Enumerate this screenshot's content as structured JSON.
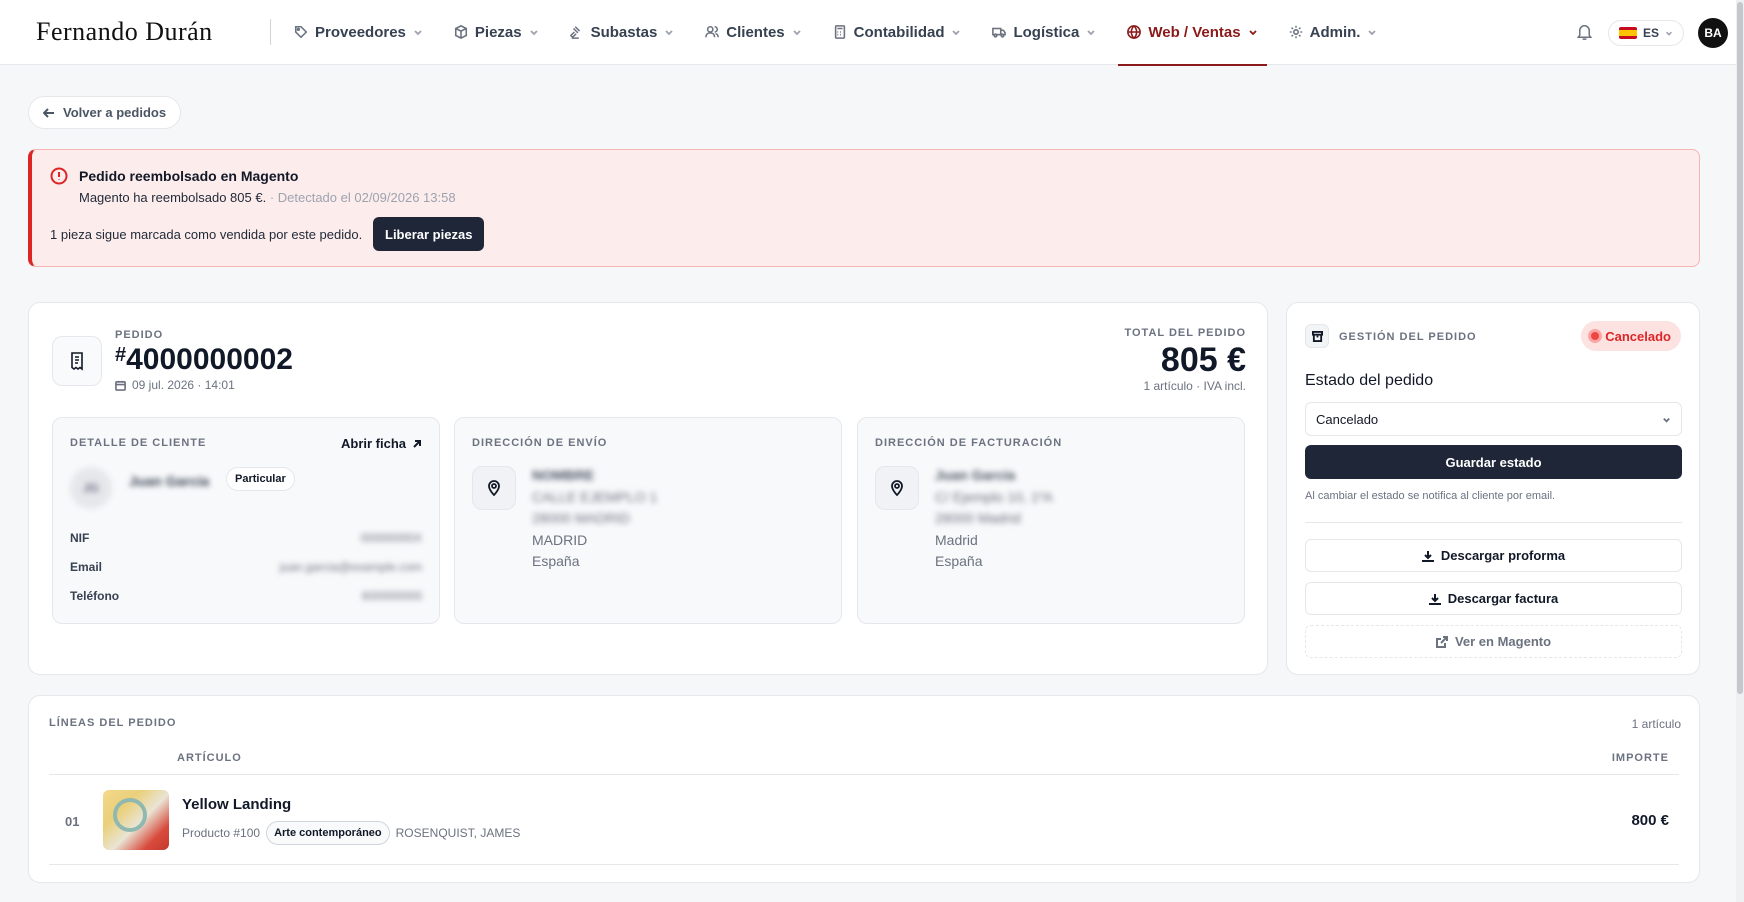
{
  "brand": "Fernando Durán",
  "nav": [
    {
      "label": "Proveedores",
      "icon": "tag-icon"
    },
    {
      "label": "Piezas",
      "icon": "cube-icon"
    },
    {
      "label": "Subastas",
      "icon": "gavel-icon"
    },
    {
      "label": "Clientes",
      "icon": "users-icon"
    },
    {
      "label": "Contabilidad",
      "icon": "calculator-icon"
    },
    {
      "label": "Logística",
      "icon": "truck-icon"
    },
    {
      "label": "Web / Ventas",
      "icon": "globe-icon",
      "active": true
    },
    {
      "label": "Admin.",
      "icon": "gear-icon"
    }
  ],
  "topbar": {
    "lang": "ES",
    "avatar": "BA"
  },
  "back_label": "Volver a pedidos",
  "alert": {
    "title": "Pedido reembolsado en Magento",
    "message": "Magento ha reembolsado 805 €.",
    "detected": "· Detectado el 02/09/2026 13:58",
    "footer": "1 pieza sigue marcada como vendida por este pedido.",
    "button": "Liberar piezas"
  },
  "order": {
    "kicker": "Pedido",
    "hash": "#",
    "number": "4000000002",
    "date": "09 jul. 2026 · 14:01",
    "total_kicker": "Total del pedido",
    "total": "805 €",
    "total_sub": "1 artículo · IVA incl."
  },
  "client": {
    "title": "Detalle de cliente",
    "open_label": "Abrir ficha",
    "initials": "JG",
    "name": "Juan García",
    "type": "Particular",
    "fields": [
      {
        "label": "NIF",
        "value": "00000000X"
      },
      {
        "label": "Email",
        "value": "juan.garcia@example.com"
      },
      {
        "label": "Teléfono",
        "value": "600000000"
      }
    ]
  },
  "shipping": {
    "title": "Dirección de envío",
    "name": "NOMBRE",
    "line1": "CALLE EJEMPLO 1",
    "line2": "28000 MADRID",
    "city": "MADRID",
    "country": "España"
  },
  "billing": {
    "title": "Dirección de facturación",
    "name": "Juan García",
    "line1": "C/ Ejemplo 10, 1ºA",
    "line2": "28000 Madrid",
    "city": "Madrid",
    "country": "España"
  },
  "management": {
    "title": "Gestión del pedido",
    "status_badge": "Cancelado",
    "state_label": "Estado del pedido",
    "selected_state": "Cancelado",
    "save_button": "Guardar estado",
    "notice": "Al cambiar el estado se notifica al cliente por email.",
    "download_proforma": "Descargar proforma",
    "download_invoice": "Descargar factura",
    "view_magento": "Ver en Magento"
  },
  "lines": {
    "title": "Líneas del pedido",
    "count": "1 artículo",
    "col_article": "Artículo",
    "col_amount": "Importe",
    "items": [
      {
        "num": "01",
        "name": "Yellow Landing",
        "product": "Producto #100",
        "category": "Arte contemporáneo",
        "artist": "ROSENQUIST, JAMES",
        "amount": "800 €"
      }
    ]
  },
  "colors": {
    "accent": "#8b1a1a",
    "dark_button": "#1e2638",
    "danger": "#dc2626"
  }
}
